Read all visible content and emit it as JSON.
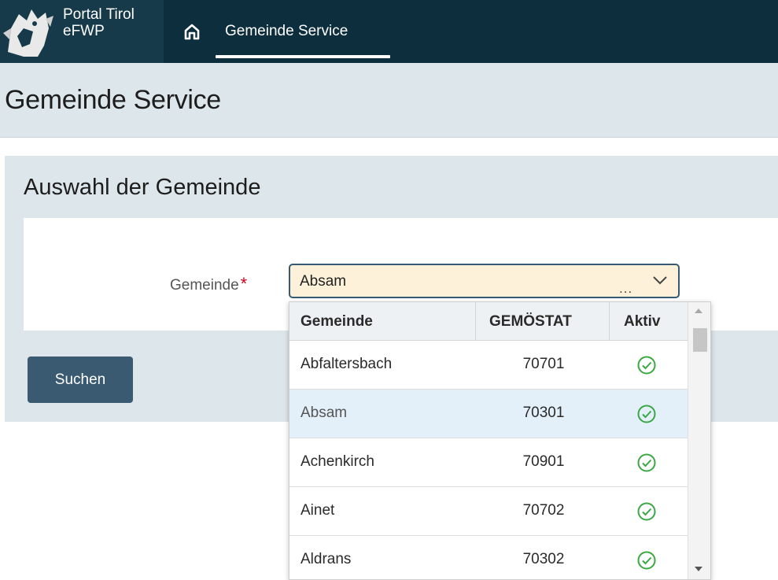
{
  "app": {
    "logo_line1": "Portal Tirol",
    "logo_line2": "eFWP",
    "nav_active": "Gemeinde Service",
    "home_icon": "home-icon"
  },
  "page": {
    "title": "Gemeinde Service"
  },
  "panel": {
    "title": "Auswahl der Gemeinde",
    "field_label": "Gemeinde",
    "required_marker": "*",
    "selected_value": "Absam",
    "dots": "...",
    "search_button": "Suchen"
  },
  "dropdown": {
    "columns": [
      "Gemeinde",
      "GEMÖSTAT",
      "Aktiv"
    ],
    "rows": [
      {
        "name": "Abfaltersbach",
        "code": "70701",
        "active": true,
        "selected": false
      },
      {
        "name": "Absam",
        "code": "70301",
        "active": true,
        "selected": true
      },
      {
        "name": "Achenkirch",
        "code": "70901",
        "active": true,
        "selected": false
      },
      {
        "name": "Ainet",
        "code": "70702",
        "active": true,
        "selected": false
      },
      {
        "name": "Aldrans",
        "code": "70302",
        "active": true,
        "selected": false
      }
    ]
  },
  "colors": {
    "topbar": "#0c2e3d",
    "accent_button": "#3a5a72",
    "select_bg": "#fdf2d9",
    "check_green": "#3aa845",
    "selected_row": "#e3eff9"
  }
}
